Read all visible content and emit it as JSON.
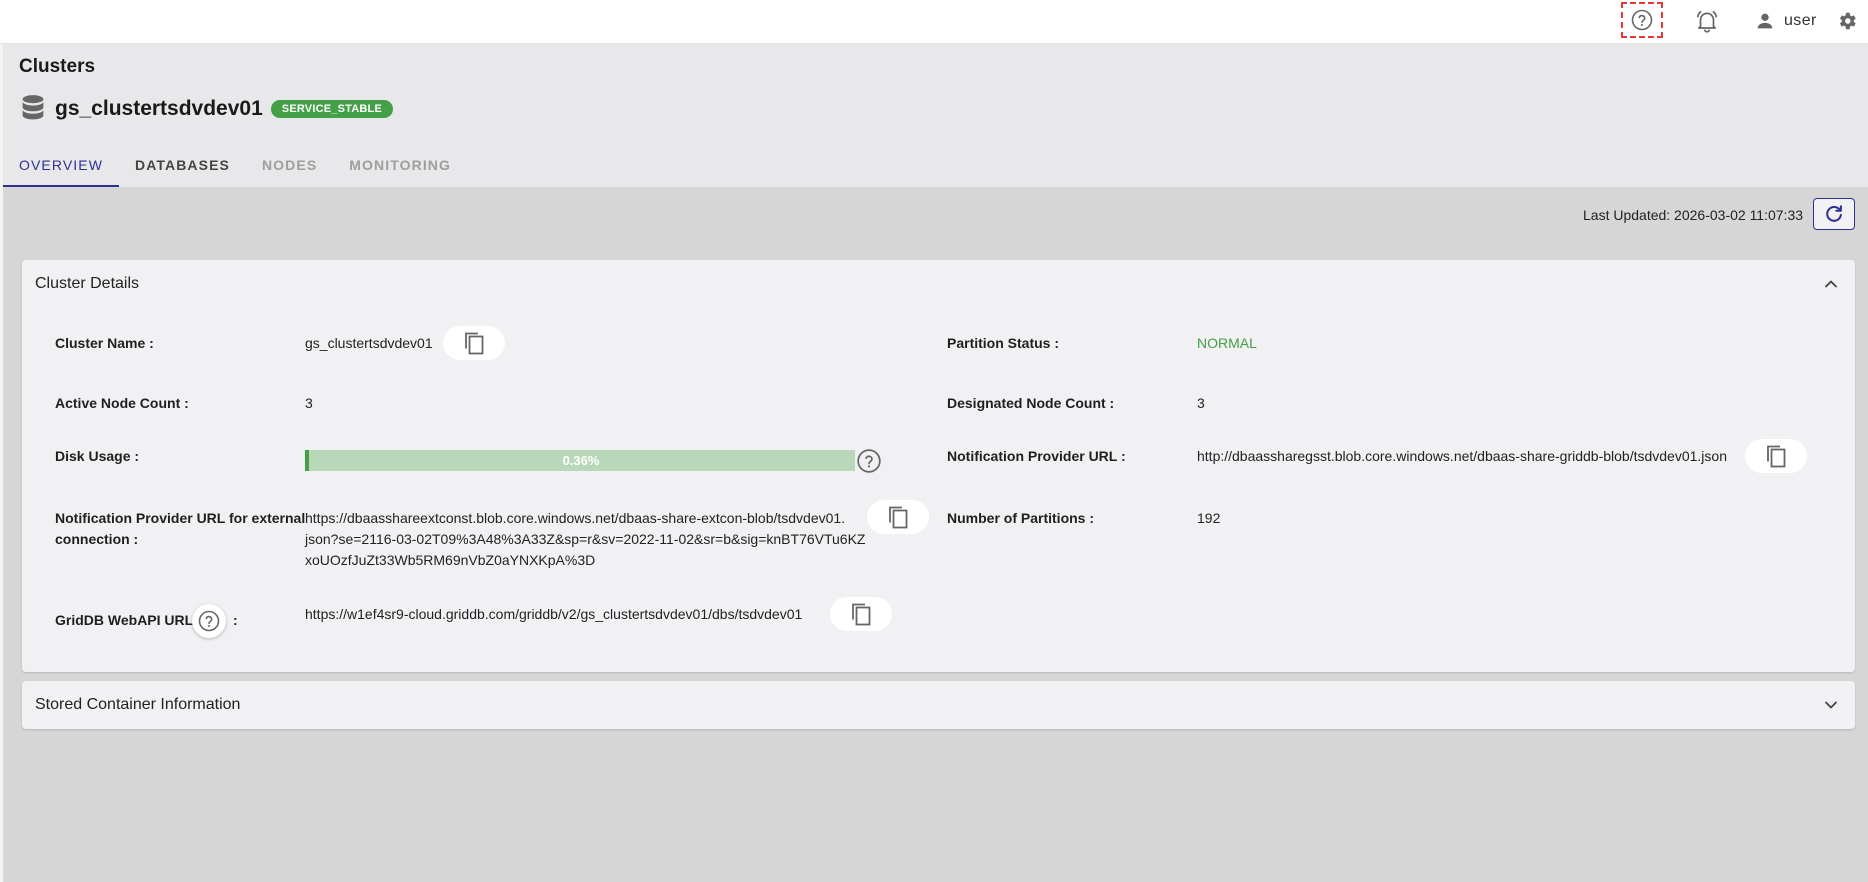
{
  "topbar": {
    "help_icon": "help-circle-icon",
    "bell_icon": "bell-icon",
    "user_icon": "person-icon",
    "user_label": "user",
    "gear_icon": "gear-icon"
  },
  "header": {
    "page_title": "Clusters",
    "cluster_name": "gs_clustertsdvdev01",
    "status": "SERVICE_STABLE",
    "tabs": [
      {
        "label": "OVERVIEW",
        "state": "active"
      },
      {
        "label": "DATABASES",
        "state": "normal"
      },
      {
        "label": "NODES",
        "state": "disabled"
      },
      {
        "label": "MONITORING",
        "state": "disabled"
      }
    ]
  },
  "toolbar": {
    "last_updated": "Last Updated: 2026-03-02 11:07:33"
  },
  "details": {
    "title": "Cluster Details",
    "cluster_name_label": "Cluster Name :",
    "cluster_name_value": "gs_clustertsdvdev01",
    "partition_status_label": "Partition Status :",
    "partition_status_value": "NORMAL",
    "active_node_label": "Active Node Count :",
    "active_node_value": "3",
    "designated_node_label": "Designated Node Count :",
    "designated_node_value": "3",
    "disk_usage_label": "Disk Usage :",
    "disk_usage_text": "0.36%",
    "disk_usage_fraction": 0.0036,
    "notif_url_label": "Notification Provider URL :",
    "notif_url_value": "http://dbaassharegsst.blob.core.windows.net/dbaas-share-griddb-blob/tsdvdev01.json",
    "ext_url_label_1": "Notification Provider URL for external",
    "ext_url_label_2": "connection :",
    "ext_url_line1": "https://dbaasshareextconst.blob.core.windows.net/dbaas-share-extcon-blob/tsdvdev01.",
    "ext_url_line2": "json?se=2116-03-02T09%3A48%3A33Z&sp=r&sv=2022-11-02&sr=b&sig=knBT76VTu6KZ",
    "ext_url_line3": "xoUOzfJuZt33Wb5RM69nVbZ0aYNXKpA%3D",
    "partitions_label": "Number of Partitions :",
    "partitions_value": "192",
    "webapi_label": "GridDB WebAPI URL",
    "webapi_colon": ":",
    "webapi_value": "https://w1ef4sr9-cloud.griddb.com/griddb/v2/gs_clustertsdvdev01/dbs/tsdvdev01"
  },
  "stored": {
    "title": "Stored Container Information"
  },
  "colors": {
    "accent": "#2d3192",
    "success": "#43a047",
    "highlight": "#e53935"
  }
}
